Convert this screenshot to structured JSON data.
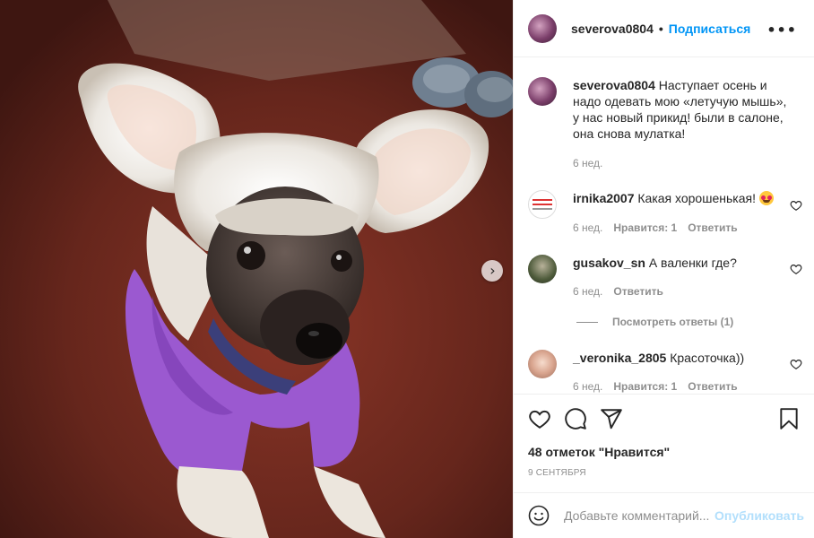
{
  "header": {
    "username": "severova0804",
    "separator": "•",
    "follow_label": "Подписаться",
    "more_label": "•••"
  },
  "photo": {
    "next_label": "›"
  },
  "caption": {
    "username": "severova0804",
    "text": "Наступает осень и надо одевать мою «летучую мышь», у нас новый прикид! были в салоне, она снова мулатка!",
    "time": "6 нед."
  },
  "comments": [
    {
      "username": "irnika2007",
      "text": "Какая хорошенькая!",
      "emoji": "heart-eyes-emoji",
      "time": "6 нед.",
      "likes": "Нравится: 1",
      "reply": "Ответить"
    },
    {
      "username": "gusakov_sn",
      "text": "А валенки где?",
      "time": "6 нед.",
      "reply": "Ответить",
      "view_replies": "Посмотреть ответы (1)"
    },
    {
      "username": "_veronika_2805",
      "text": "Красоточка))",
      "time": "6 нед.",
      "likes": "Нравится: 1",
      "reply": "Ответить"
    }
  ],
  "stats": {
    "likes": "48 отметок \"Нравится\"",
    "date": "9 сентября"
  },
  "add_comment": {
    "placeholder": "Добавьте комментарий...",
    "publish_label": "Опубликовать"
  },
  "icons": {
    "like": "heart-icon",
    "comment": "comment-icon",
    "share": "paper-plane-icon",
    "save": "bookmark-icon",
    "emoji": "smiley-icon",
    "next": "chevron-right-icon",
    "more": "more-options-icon"
  },
  "colors": {
    "accent": "#0095f6",
    "publish_disabled": "#b2dffc",
    "secondary_text": "#8e8e8e",
    "primary_text": "#262626",
    "border": "#efefef",
    "sweater": "#9b59d0"
  }
}
